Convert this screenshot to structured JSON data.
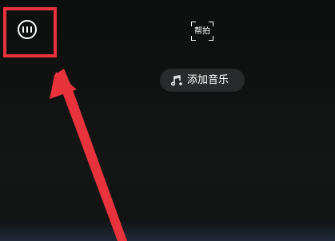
{
  "top_bar": {
    "menu_icon": "more-options-circle-icon",
    "help_shoot": {
      "label": "帮拍",
      "icon": "scan-frame-icon"
    }
  },
  "add_music": {
    "label": "添加音乐",
    "icon": "music-note-plus-icon"
  },
  "annotation": {
    "highlight_color": "#e8323c",
    "arrow_color": "#e8323c"
  }
}
